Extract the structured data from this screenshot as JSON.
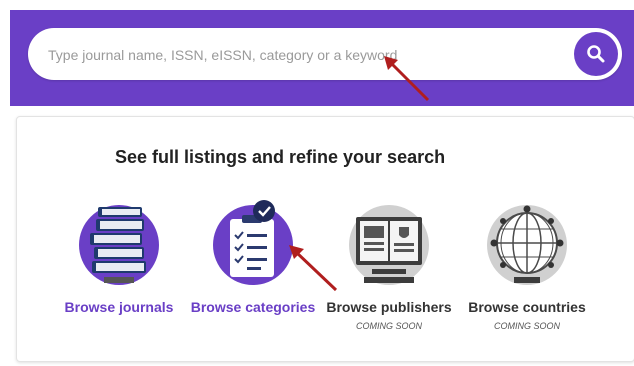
{
  "search": {
    "placeholder": "Type journal name, ISSN, eISSN, category or a keyword",
    "button_icon": "search-icon"
  },
  "browse_section": {
    "title": "See full listings and refine your search",
    "items": [
      {
        "label": "Browse journals",
        "icon": "journals-icon",
        "status": ""
      },
      {
        "label": "Browse categories",
        "icon": "categories-icon",
        "status": ""
      },
      {
        "label": "Browse publishers",
        "icon": "publishers-icon",
        "status": "COMING SOON"
      },
      {
        "label": "Browse countries",
        "icon": "countries-icon",
        "status": "COMING SOON"
      }
    ]
  },
  "colors": {
    "accent": "#6a3fc6",
    "annotation_arrow": "#b01e1e",
    "card_border": "#e3e3e3"
  }
}
